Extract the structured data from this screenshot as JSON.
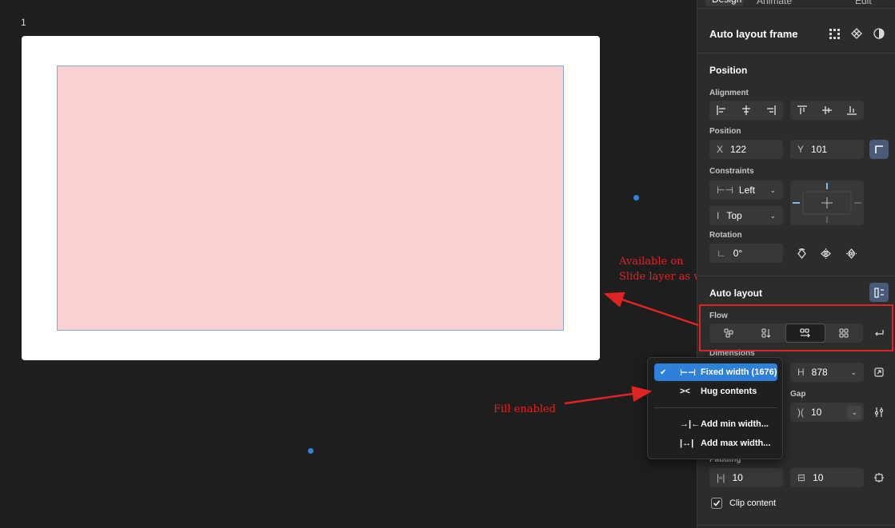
{
  "canvas": {
    "frame_label": "1"
  },
  "annotations": {
    "slide_note_line1": "Available on",
    "slide_note_line2": "Slide layer as well",
    "fill_note": "Fill enabled",
    "color": "#e02424"
  },
  "panel": {
    "tabs": [
      "Design",
      "Animate",
      "Edit"
    ],
    "title": "Auto layout frame",
    "title_icons": [
      "grid-icon",
      "component-icon",
      "mask-icon"
    ],
    "position_section": "Position",
    "alignment_label": "Alignment",
    "position_label": "Position",
    "x_prefix": "X",
    "x_value": "122",
    "y_prefix": "Y",
    "y_value": "101",
    "constraints_label": "Constraints",
    "constraint_h": "Left",
    "constraint_v": "Top",
    "rotation_label": "Rotation",
    "rotation_value": "0°",
    "auto_layout_section": "Auto layout",
    "flow_label": "Flow",
    "dimensions_label": "Dimensions",
    "h_prefix": "H",
    "h_value": "878",
    "gap_label": "Gap",
    "gap_value": "10",
    "padding_label": "Padding",
    "padding_h": "10",
    "padding_v": "10",
    "clip_content_label": "Clip content",
    "clip_content_checked": true
  },
  "dropdown": {
    "items": [
      {
        "label": "Fixed width (1676)",
        "icon": "fixed-width-icon",
        "selected": true
      },
      {
        "label": "Hug contents",
        "icon": "hug-contents-icon",
        "selected": false
      },
      {
        "label": "Add min width...",
        "icon": "min-width-icon",
        "selected": false
      },
      {
        "label": "Add max width...",
        "icon": "max-width-icon",
        "selected": false
      }
    ]
  },
  "colors": {
    "accent": "#2f80d8",
    "selection_stroke": "#7fa8d8",
    "inner_fill": "#f9d1d3",
    "annotation_red": "#e02424"
  }
}
